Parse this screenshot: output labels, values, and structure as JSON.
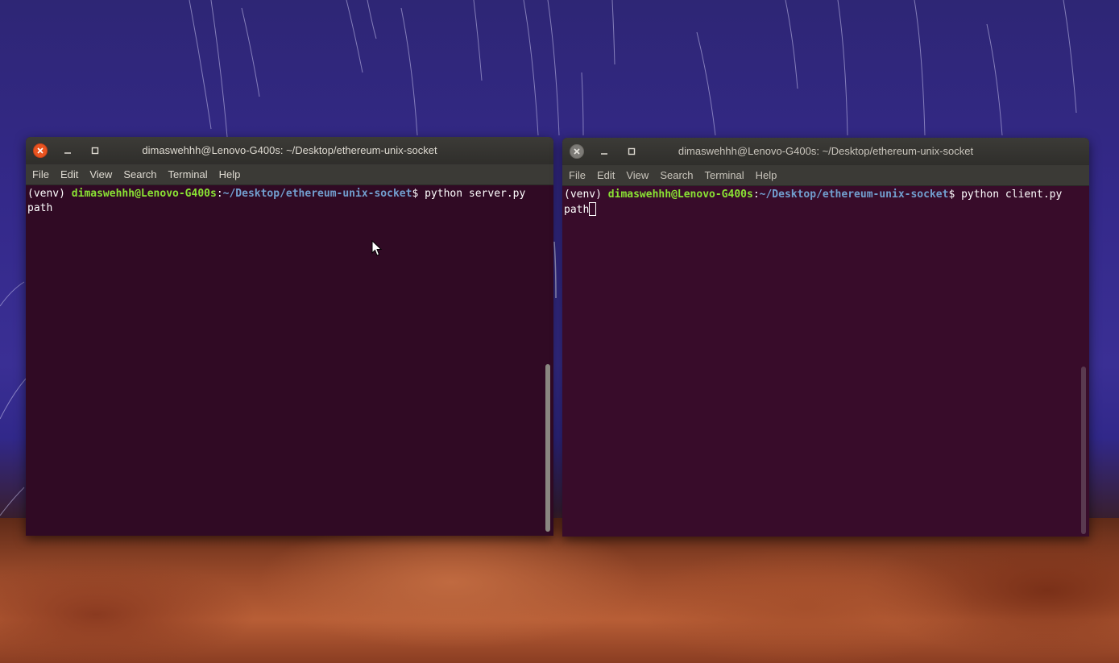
{
  "desktop": {
    "wallpaper": "star-trails over red rock"
  },
  "windows": [
    {
      "id": "server",
      "title": "dimaswehhh@Lenovo-G400s: ~/Desktop/ethereum-unix-socket",
      "focused": true,
      "menu": [
        "File",
        "Edit",
        "View",
        "Search",
        "Terminal",
        "Help"
      ],
      "prompt": {
        "venv": "(venv) ",
        "user_host": "dimaswehhh@Lenovo-G400s",
        "sep": ":",
        "path": "~/Desktop/ethereum-unix-socket",
        "dollar": "$ ",
        "command": "python server.py"
      },
      "output": "path"
    },
    {
      "id": "client",
      "title": "dimaswehhh@Lenovo-G400s: ~/Desktop/ethereum-unix-socket",
      "focused": false,
      "menu": [
        "File",
        "Edit",
        "View",
        "Search",
        "Terminal",
        "Help"
      ],
      "prompt": {
        "venv": "(venv) ",
        "user_host": "dimaswehhh@Lenovo-G400s",
        "sep": ":",
        "path": "~/Desktop/ethereum-unix-socket",
        "dollar": "$ ",
        "command": "python client.py"
      },
      "output": "path"
    }
  ],
  "icons": {
    "close": "close-icon",
    "minimize": "minimize-icon",
    "maximize": "maximize-icon",
    "pointer": "mouse-pointer-icon"
  },
  "colors": {
    "terminal_bg": "#300a24",
    "prompt_user": "#8ae234",
    "prompt_path": "#729fcf",
    "close_active": "#e95420"
  }
}
